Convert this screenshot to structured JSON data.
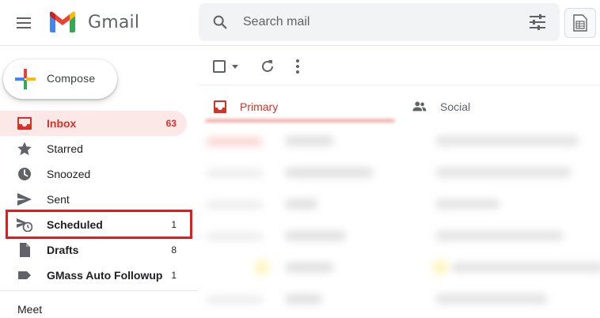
{
  "app": {
    "brand": "Gmail"
  },
  "search": {
    "placeholder": "Search mail"
  },
  "compose": {
    "label": "Compose"
  },
  "sidebar": {
    "items": [
      {
        "label": "Inbox",
        "count": "63",
        "icon": "inbox-icon",
        "active": true
      },
      {
        "label": "Starred",
        "count": "",
        "icon": "star-icon"
      },
      {
        "label": "Snoozed",
        "count": "",
        "icon": "clock-icon"
      },
      {
        "label": "Sent",
        "count": "",
        "icon": "send-icon"
      },
      {
        "label": "Scheduled",
        "count": "1",
        "icon": "scheduled-send-icon",
        "highlighted": true
      },
      {
        "label": "Drafts",
        "count": "8",
        "icon": "draft-icon"
      },
      {
        "label": "GMass Auto Followup",
        "count": "1",
        "icon": "label-icon"
      }
    ],
    "meet_heading": "Meet"
  },
  "tabs": [
    {
      "label": "Primary",
      "icon": "inbox-icon"
    },
    {
      "label": "Social",
      "icon": "people-icon"
    }
  ],
  "colors": {
    "accent": "#d93025",
    "active_bg": "#fce8e6",
    "highlight_box": "#e31b1b",
    "search_bg": "#f1f3f4"
  }
}
